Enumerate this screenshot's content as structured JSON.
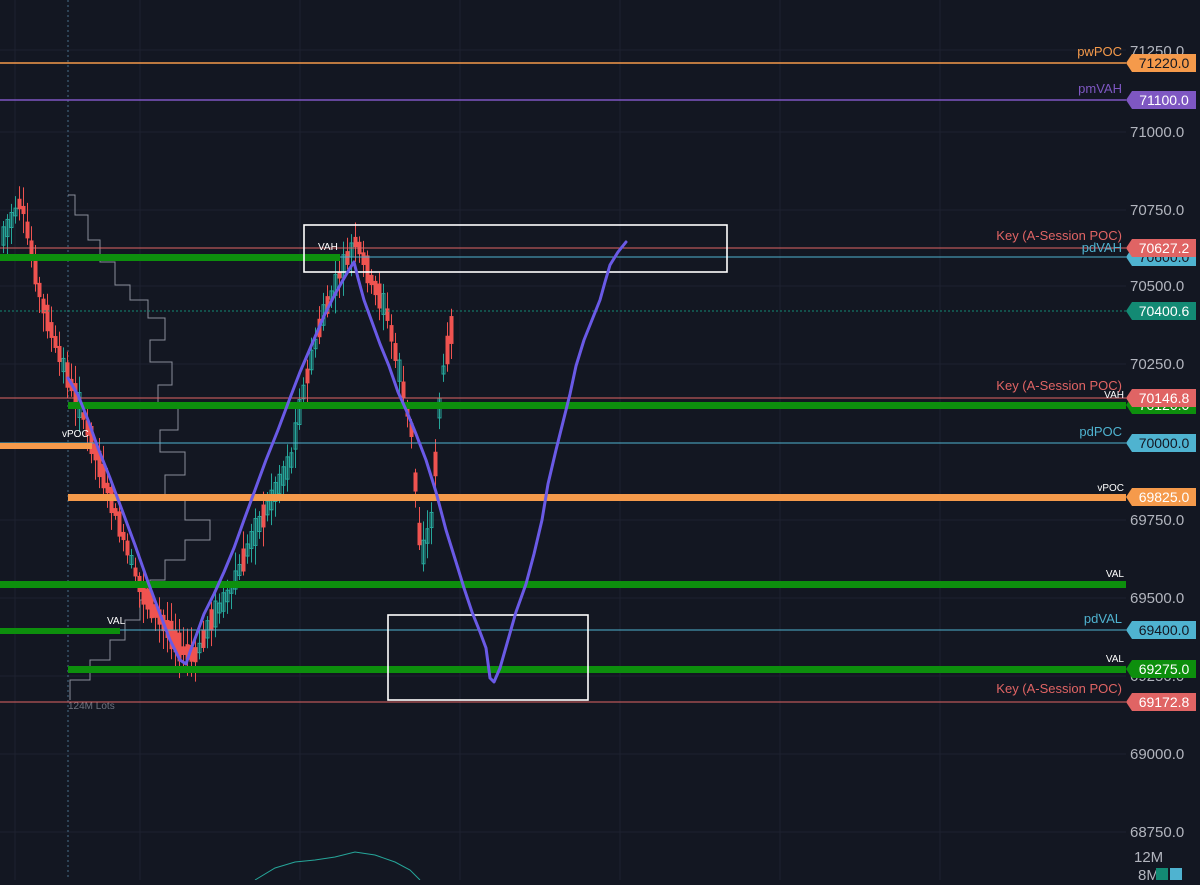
{
  "colors": {
    "background": "#131722",
    "grid": "#1e2230",
    "axis_text": "#b2b5be",
    "orange": "#f59a4b",
    "purple": "#7e57c2",
    "red": "#e06464",
    "teal_blue": "#4fb3d0",
    "green": "#0d8f0d",
    "teal_badge": "#138a74",
    "bull": "#26a69a",
    "bear": "#ef5350",
    "drawn_path": "#6a5ae6",
    "box": "#ffffff",
    "profile": "#8a8e99"
  },
  "price_axis": {
    "ticks": [
      "71250.0",
      "71000.0",
      "70750.0",
      "70500.0",
      "70250.0",
      "69750.0",
      "69500.0",
      "69250.0",
      "69000.0",
      "68750.0"
    ],
    "volume_tick": "12M",
    "volume_tick_lower": "8M"
  },
  "levels": {
    "pwpoc": {
      "label": "pwPOC",
      "badge": "71220.0"
    },
    "pmvah": {
      "label": "pmVAH",
      "badge": "71100.0"
    },
    "key_top": {
      "label": "Key (A-Session POC)",
      "badge": "70627.2"
    },
    "pdvah": {
      "label": "pdVAH",
      "badge": "70600.0"
    },
    "last_price": {
      "badge": "70400.6"
    },
    "key_mid": {
      "label": "Key (A-Session POC)",
      "badge": "70146.8"
    },
    "vah_green": {
      "label": "VAH",
      "badge": "70120.0"
    },
    "pdpoc": {
      "label": "pdPOC",
      "badge": "70000.0"
    },
    "vpoc_orange": {
      "label": "vPOC",
      "badge": "69825.0"
    },
    "val_green_a": {
      "label": "VAL"
    },
    "pdval": {
      "label": "pdVAL",
      "badge": "69400.0"
    },
    "val_green_b": {
      "label": "VAL",
      "badge": "69275.0"
    },
    "key_low": {
      "label": "Key (A-Session POC)",
      "badge": "69172.8"
    }
  },
  "chart_labels": {
    "left_vpoc": "vPOC",
    "left_val": "VAL",
    "left_vah": "VAH",
    "profile_volume": "124M Lots"
  }
}
